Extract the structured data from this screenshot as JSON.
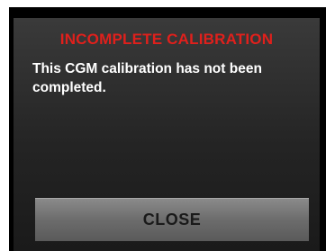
{
  "dialog": {
    "title": "INCOMPLETE CALIBRATION",
    "message": "This CGM calibration has not been completed.",
    "close_label": "CLOSE"
  },
  "colors": {
    "title": "#e0201c",
    "message": "#ffffff",
    "button_text": "#1a1a1a",
    "device_bezel": "#000000"
  }
}
